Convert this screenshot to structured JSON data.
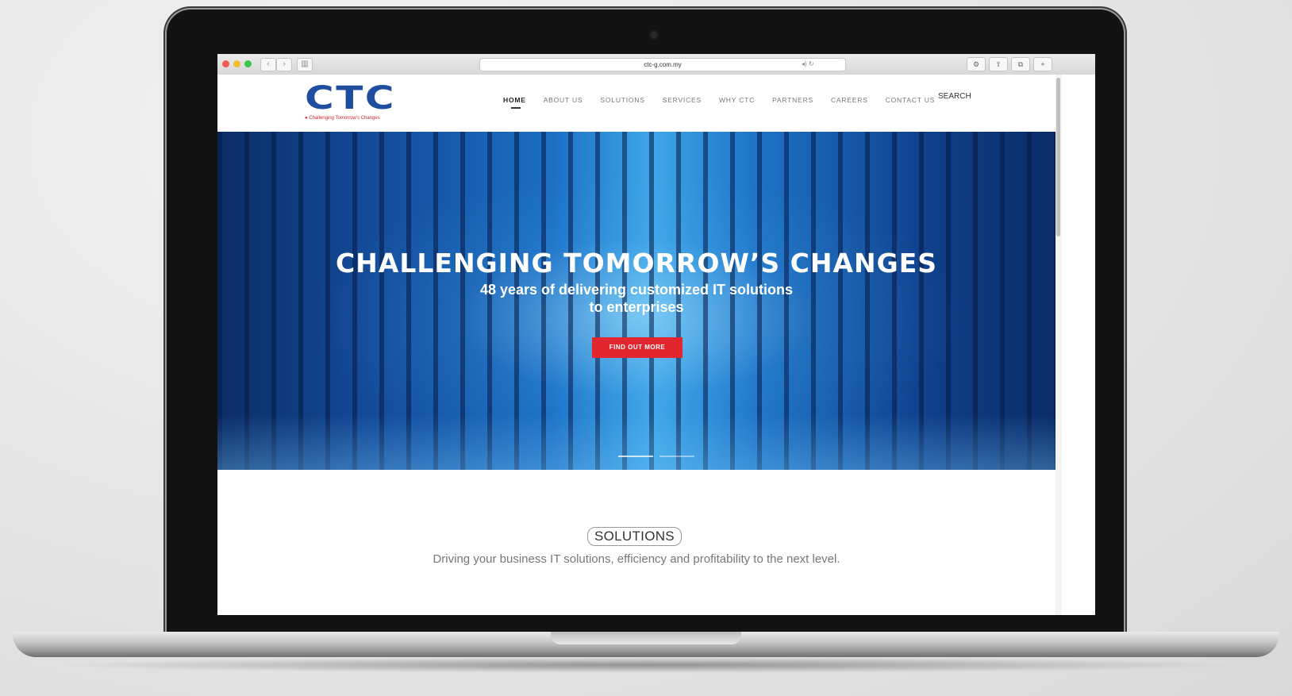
{
  "browser": {
    "url": "ctc-g.com.my"
  },
  "header": {
    "logo_text": "CTC",
    "logo_tagline": "● Challenging Tomorrow's Changes",
    "nav": [
      {
        "label": "HOME",
        "active": true
      },
      {
        "label": "ABOUT US",
        "active": false
      },
      {
        "label": "SOLUTIONS",
        "active": false
      },
      {
        "label": "SERVICES",
        "active": false
      },
      {
        "label": "WHY CTC",
        "active": false
      },
      {
        "label": "PARTNERS",
        "active": false
      },
      {
        "label": "CAREERS",
        "active": false
      },
      {
        "label": "CONTACT US",
        "active": false
      }
    ],
    "search_label": "SEARCH"
  },
  "hero": {
    "title": "CHALLENGING TOMORROW’S CHANGES",
    "subtitle_line1": "48 years of delivering customized IT solutions",
    "subtitle_line2": "to enterprises",
    "cta_label": "FIND OUT MORE"
  },
  "solutions": {
    "title": "SOLUTIONS",
    "subtitle": "Driving your business IT solutions, efficiency and profitability to the next level."
  },
  "colors": {
    "brand_blue": "#1f4ea1",
    "accent_red": "#e2262f"
  }
}
